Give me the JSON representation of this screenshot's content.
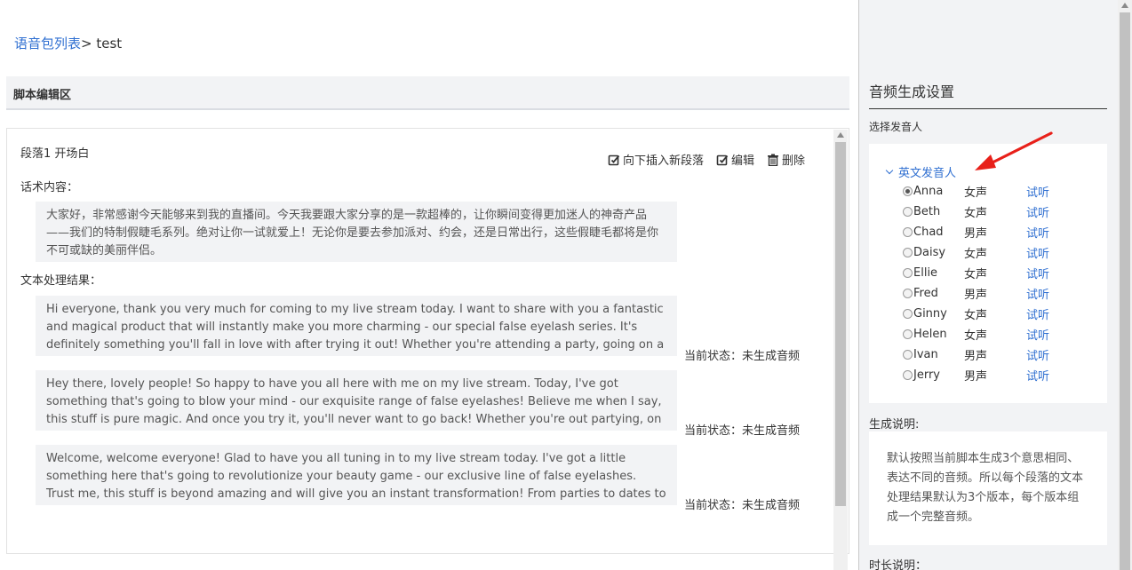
{
  "breadcrumb": {
    "link": "语音包列表",
    "separator": "> ",
    "current": "test"
  },
  "section": {
    "title": "脚本编辑区"
  },
  "paragraph": {
    "title": "段落1 开场白",
    "actions": {
      "insert": "向下插入新段落",
      "edit": "编辑",
      "delete": "删除"
    },
    "script_label": "话术内容：",
    "script_text": "大家好，非常感谢今天能够来到我的直播间。今天我要跟大家分享的是一款超棒的，让你瞬间变得更加迷人的神奇产品——我们的特制假睫毛系列。绝对让你一试就爱上！无论你是要去参加派对、约会，还是日常出行，这些假睫毛都将是你不可或缺的美丽伴侣。",
    "result_label": "文本处理结果：",
    "results": [
      {
        "text": "Hi everyone, thank you very much for coming to my live stream today. I want to share with you a fantastic and magical product that will instantly make you more charming - our special false eyelash series. It's definitely something you'll fall in love with after trying it out! Whether you're attending a party, going on a date, or just",
        "status": "当前状态：未生成音频"
      },
      {
        "text": "Hey there, lovely people! So happy to have you all here with me on my live stream. Today, I've got something that's going to blow your mind - our exquisite range of false eyelashes! Believe me when I say, this stuff is pure magic. And once you try it, you'll never want to go back! Whether you're out partying, on a romantic evening, or",
        "status": "当前状态：未生成音频"
      },
      {
        "text": "Welcome, welcome everyone! Glad to have you all tuning in to my live stream today. I've got a little something here that's going to revolutionize your beauty game - our exclusive line of false eyelashes. Trust me, this stuff is beyond amazing and will give you an instant transformation! From parties to dates to everyday hustle, these",
        "status": "当前状态：未生成音频"
      }
    ]
  },
  "settings": {
    "title": "音频生成设置",
    "select_label": "选择发音人",
    "group": "英文发音人",
    "listen_label": "试听",
    "speakers": [
      {
        "name": "Anna",
        "gender": "女声",
        "checked": true
      },
      {
        "name": "Beth",
        "gender": "女声",
        "checked": false
      },
      {
        "name": "Chad",
        "gender": "男声",
        "checked": false
      },
      {
        "name": "Daisy",
        "gender": "女声",
        "checked": false
      },
      {
        "name": "Ellie",
        "gender": "女声",
        "checked": false
      },
      {
        "name": "Fred",
        "gender": "男声",
        "checked": false
      },
      {
        "name": "Ginny",
        "gender": "女声",
        "checked": false
      },
      {
        "name": "Helen",
        "gender": "女声",
        "checked": false
      },
      {
        "name": "Ivan",
        "gender": "男声",
        "checked": false
      },
      {
        "name": "Jerry",
        "gender": "男声",
        "checked": false
      }
    ],
    "gen_label": "生成说明:",
    "gen_text": "默认按照当前脚本生成3个意思相同、表达不同的音频。所以每个段落的文本处理结果默认为3个版本，每个版本组成一个完整音频。",
    "duration_label": "时长说明："
  },
  "colors": {
    "link": "#2f6fd1",
    "panel_bg": "#f2f3f5",
    "annotation": "#e8201a"
  }
}
